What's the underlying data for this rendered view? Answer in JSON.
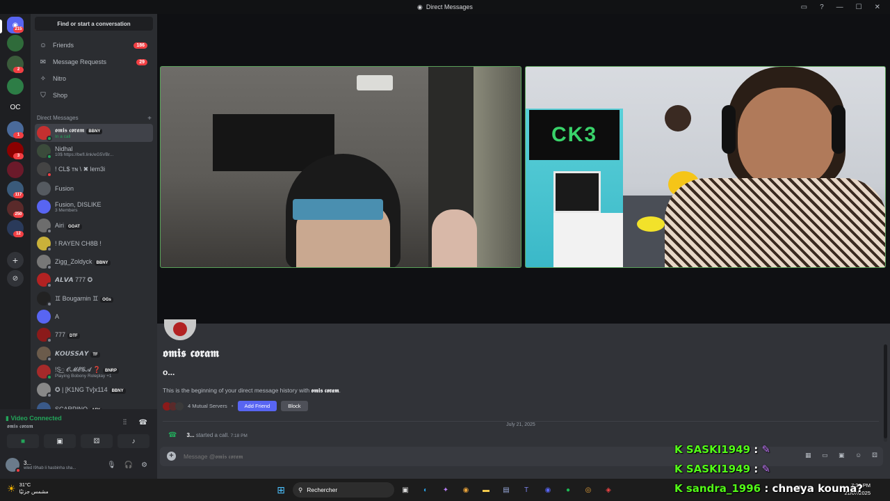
{
  "window": {
    "title": "Direct Messages"
  },
  "sidebar": {
    "search": "Find or start a conversation",
    "nav": [
      {
        "label": "Friends",
        "badge": "186",
        "icon": "friends-icon"
      },
      {
        "label": "Message Requests",
        "badge": "29",
        "icon": "mail-icon"
      },
      {
        "label": "Nitro",
        "badge": "",
        "icon": "nitro-icon"
      },
      {
        "label": "Shop",
        "badge": "",
        "icon": "shop-icon"
      }
    ],
    "dm_header": "Direct Messages",
    "dm_add": "+",
    "dms": [
      {
        "name": "𝖔𝖒𝖎𝖘 𝖈𝖔𝖗𝖆𝖒",
        "tag": "BBNY",
        "sub": "In a call",
        "color": "#c53030",
        "status": "#23a55a"
      },
      {
        "name": "Nidhal",
        "tag": "",
        "sub": "10$ https://befl.link/eG5VBr...",
        "color": "#3b4b3b",
        "status": "#23a55a"
      },
      {
        "name": "! CL$ ᴛɴ \\ ✖ lem3i",
        "tag": "",
        "sub": "",
        "color": "#444",
        "status": "#f23f43"
      },
      {
        "name": "Fusion",
        "tag": "",
        "sub": "",
        "color": "#555a60",
        "status": ""
      },
      {
        "name": "Fusion, DISLIKE",
        "tag": "",
        "sub": "3 Members",
        "color": "#5865f2",
        "status": ""
      },
      {
        "name": "Airi",
        "tag": "GOAT",
        "sub": "",
        "color": "#6d6d6d",
        "status": "#80848e"
      },
      {
        "name": "! RAYEN CH8B !",
        "tag": "",
        "sub": "",
        "color": "#c9b13a",
        "status": "#80848e"
      },
      {
        "name": "Zigg_Zoldyck",
        "tag": "BBNY",
        "sub": "",
        "color": "#777",
        "status": "#80848e"
      },
      {
        "name": "𝘼𝙇𝙑𝘼 777 ✪",
        "tag": "",
        "sub": "",
        "color": "#b22222",
        "status": "#80848e"
      },
      {
        "name": "♊ Bougarnin ♊",
        "tag": "OGs",
        "sub": "",
        "color": "#222",
        "status": "#80848e"
      },
      {
        "name": "A",
        "tag": "",
        "sub": "",
        "color": "#5865f2",
        "status": ""
      },
      {
        "name": "777",
        "tag": "DTF",
        "sub": "",
        "color": "#8b1a1a",
        "status": "#80848e"
      },
      {
        "name": "𝙆𝙊𝙐𝙎𝙎𝘼𝙔",
        "tag": "TF",
        "sub": "",
        "color": "#6b5b4b",
        "status": "#80848e"
      },
      {
        "name": "!S꯭ 𝓞𝓜𝓔𝓖𝓐 ❓",
        "tag": "BNRP",
        "sub": "Playing Bobony Roleplay +1",
        "color": "#a52a2a",
        "status": "#23a55a"
      },
      {
        "name": "✪ | [K1NG Tv]x114",
        "tag": "BBNY",
        "sub": "",
        "color": "#888",
        "status": "#80848e"
      },
      {
        "name": "SCARPINO",
        "tag": "AFK",
        "sub": "",
        "color": "#3a5a8a",
        "status": "#80848e"
      }
    ]
  },
  "guilds": {
    "home_badge": "215",
    "items": [
      {
        "label": "",
        "badge": "",
        "color": "#2f6b3a"
      },
      {
        "label": "",
        "badge": "2",
        "color": "#3b5b3b"
      },
      {
        "label": "",
        "badge": "",
        "color": "#2d7d46"
      },
      {
        "label": "OC",
        "badge": "",
        "color": "#1e1f22"
      },
      {
        "label": "",
        "badge": "1",
        "color": "#4a6a9a"
      },
      {
        "label": "",
        "badge": "3",
        "color": "#8b0000"
      },
      {
        "label": "",
        "badge": "",
        "color": "#6b1a2a"
      },
      {
        "label": "",
        "badge": "117",
        "color": "#3a5a7a"
      },
      {
        "label": "",
        "badge": "250",
        "color": "#5a2a2a"
      },
      {
        "label": "",
        "badge": "12",
        "color": "#2a3a5a"
      }
    ],
    "add": "+",
    "explore": "⊘"
  },
  "voice": {
    "status": "Video Connected",
    "channel": "𝖔𝖒𝖎𝖘 𝖈𝖔𝖗𝖆𝖒"
  },
  "user": {
    "name": "3...",
    "status": "wled l9hab li hasbinha sha..."
  },
  "chat": {
    "name": "𝖔𝖒𝖎𝖘 𝖈𝖔𝖗𝖆𝖒",
    "handle": "o...",
    "intro_prefix": "This is the beginning of your direct message history with ",
    "intro_name": "𝖔𝖒𝖎𝖘 𝖈𝖔𝖗𝖆𝖒",
    "intro_suffix": ".",
    "mutual": "4 Mutual Servers",
    "add_friend": "Add Friend",
    "block": "Block",
    "date": "July 21, 2025",
    "call_user": "3...",
    "call_text": "started a call.",
    "call_time": "7:18 PM",
    "placeholder": "Message @𝖔𝖒𝖎𝖘 𝖈𝖔𝖗𝖆𝖒"
  },
  "overlay": [
    {
      "user": "SASKI1949",
      "msg": ":"
    },
    {
      "user": "SASKI1949",
      "msg": ":"
    },
    {
      "user": "sandra_1996",
      "msg": ": chneya kouma?"
    }
  ],
  "taskbar": {
    "weather_temp": "31°C",
    "weather_desc": "مشمس جزئيًا",
    "search": "Rechercher",
    "lang": "FR",
    "time": "7:39 PM",
    "date": "21/07/2025"
  },
  "colors": {
    "accent": "#5865f2",
    "green": "#23a55a",
    "red": "#f23f43",
    "kick": "#53fc18"
  }
}
